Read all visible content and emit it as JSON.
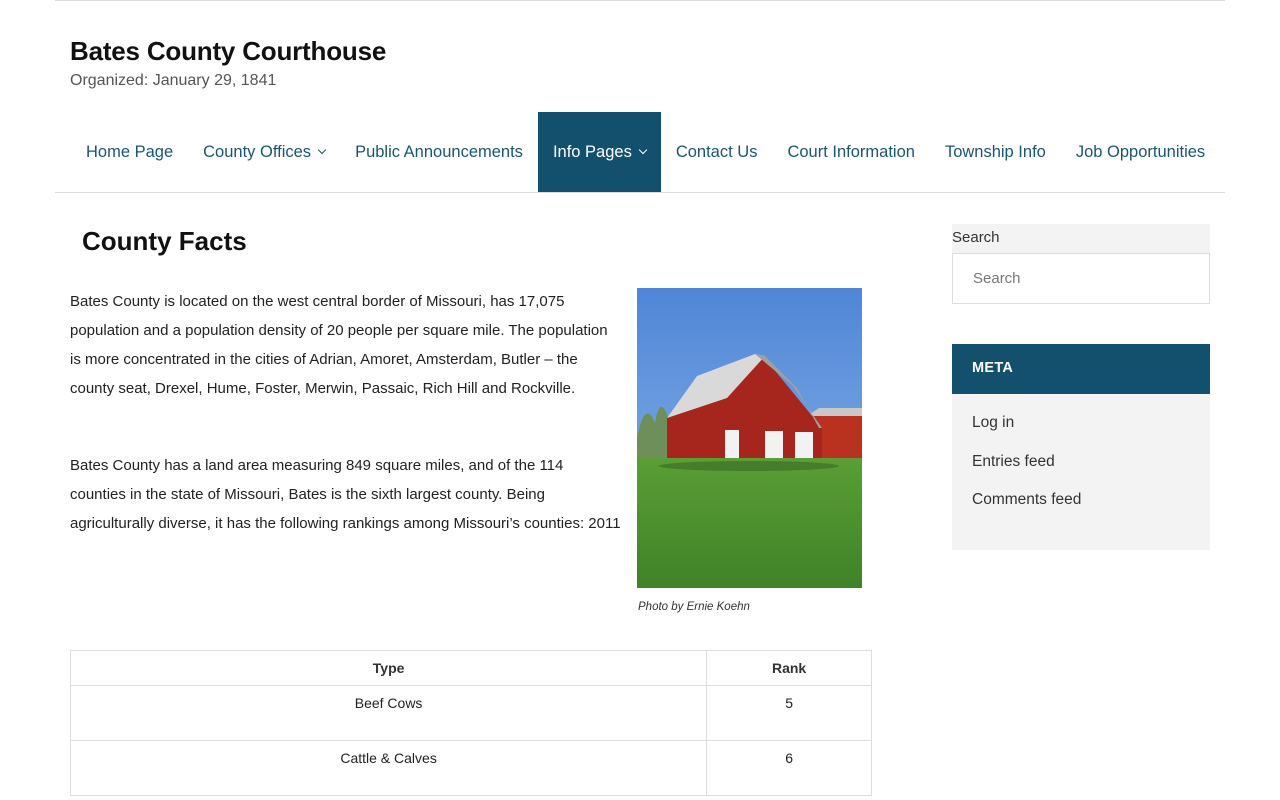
{
  "site": {
    "title": "Bates County Courthouse",
    "tagline": "Organized: January 29, 1841"
  },
  "nav": {
    "items": [
      {
        "label": "Home Page",
        "has_dropdown": false,
        "active": false
      },
      {
        "label": "County Offices",
        "has_dropdown": true,
        "active": false
      },
      {
        "label": "Public Announcements",
        "has_dropdown": false,
        "active": false
      },
      {
        "label": "Info Pages",
        "has_dropdown": true,
        "active": true
      },
      {
        "label": "Contact Us",
        "has_dropdown": false,
        "active": false
      },
      {
        "label": "Court Information",
        "has_dropdown": false,
        "active": false
      },
      {
        "label": "Township Info",
        "has_dropdown": false,
        "active": false
      },
      {
        "label": "Job Opportunities",
        "has_dropdown": false,
        "active": false
      }
    ]
  },
  "main": {
    "title": "County Facts",
    "paragraphs": [
      "Bates County is located on the west central border of Missouri, has 17,075 population and a population density of 20 people per square mile.  The population is more concentrated in the cities of Adrian, Amoret, Amsterdam, Butler – the county seat, Drexel, Hume, Foster, Merwin, Passaic, Rich Hill and Rockville.",
      "Bates County has a land area measuring 849 square miles, and of the 114 counties in the state of Missouri, Bates is the sixth largest county. Being agriculturally diverse, it has the following rankings among Missouri’s counties: 2011"
    ],
    "photo_caption": "Photo by Ernie Koehn",
    "table": {
      "headers": [
        "Type",
        "Rank"
      ],
      "rows": [
        [
          "Beef Cows",
          "5"
        ],
        [
          "Cattle & Calves",
          "6"
        ]
      ]
    }
  },
  "sidebar": {
    "search": {
      "label": "Search",
      "placeholder": "Search"
    },
    "meta": {
      "title": "META",
      "links": [
        "Log in",
        "Entries feed",
        "Comments feed"
      ]
    }
  },
  "colors": {
    "accent": "#12506d",
    "link": "#1a5573",
    "widget_bg": "#f3f3f3"
  }
}
